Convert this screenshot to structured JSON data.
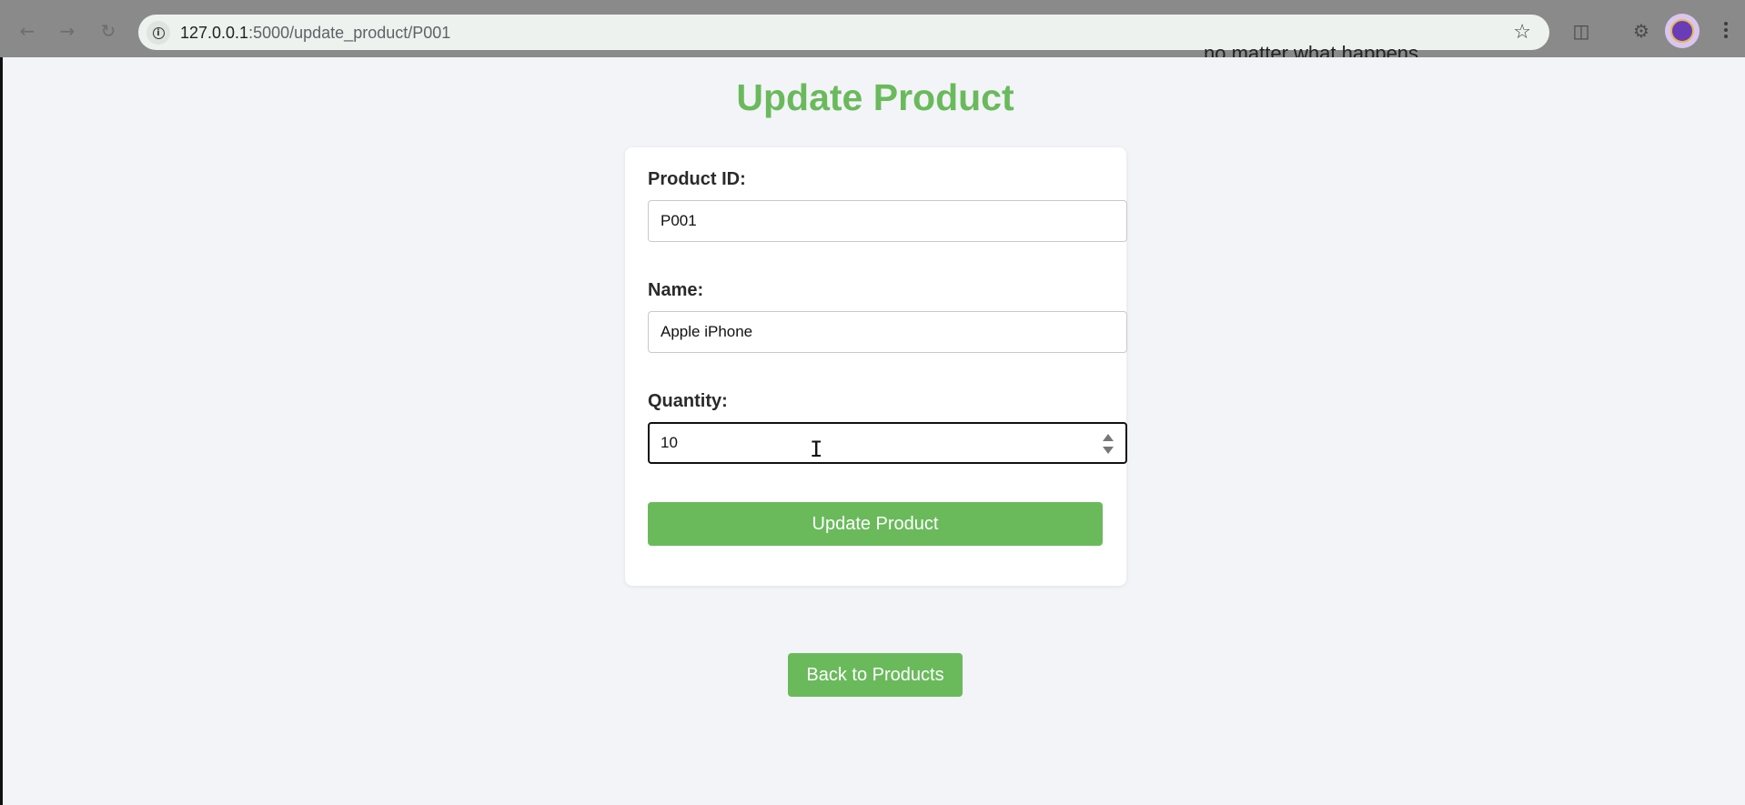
{
  "browser": {
    "url_host": "127.0.0.1",
    "url_path": ":5000/update_product/P001",
    "background_text": "no matter what happens"
  },
  "page": {
    "title": "Update Product"
  },
  "form": {
    "product_id_label": "Product ID:",
    "product_id_value": "P001",
    "name_label": "Name:",
    "name_value": "Apple iPhone",
    "quantity_label": "Quantity:",
    "quantity_value": "10",
    "submit_label": "Update Product"
  },
  "back_button_label": "Back to Products",
  "colors": {
    "accent": "#6aba5c",
    "page_background": "#f3f4f8"
  }
}
